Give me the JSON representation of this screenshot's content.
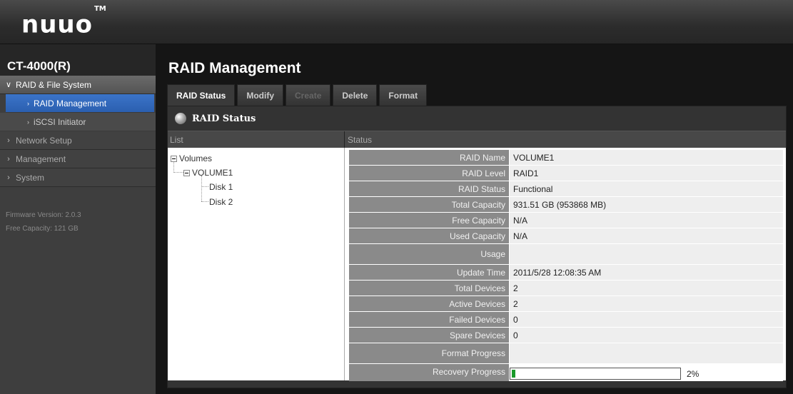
{
  "brand": {
    "logo_text": "nuuo",
    "trademark": "TM"
  },
  "sidebar": {
    "device_name": "CT-4000(R)",
    "sections": [
      {
        "label": "RAID & File System",
        "expanded": true,
        "children": [
          {
            "label": "RAID Management",
            "active": true
          },
          {
            "label": "iSCSI Initiator",
            "active": false
          }
        ]
      },
      {
        "label": "Network Setup",
        "expanded": false
      },
      {
        "label": "Management",
        "expanded": false
      },
      {
        "label": "System",
        "expanded": false
      }
    ],
    "firmware_version": "Firmware Version: 2.0.3",
    "free_capacity": "Free Capacity: 121 GB"
  },
  "main": {
    "title": "RAID Management",
    "tabs": [
      {
        "label": "RAID Status",
        "state": "active"
      },
      {
        "label": "Modify",
        "state": "normal"
      },
      {
        "label": "Create",
        "state": "disabled"
      },
      {
        "label": "Delete",
        "state": "normal"
      },
      {
        "label": "Format",
        "state": "normal"
      }
    ],
    "panel_title": "RAID Status",
    "list_header": "List",
    "status_header": "Status",
    "tree": {
      "root": "Volumes",
      "volume": "VOLUME1",
      "disks": [
        "Disk 1",
        "Disk 2"
      ]
    },
    "status_rows": [
      {
        "label": "RAID Name",
        "value": "VOLUME1"
      },
      {
        "label": "RAID Level",
        "value": "RAID1"
      },
      {
        "label": "RAID Status",
        "value": "Functional"
      },
      {
        "label": "Total Capacity",
        "value": "931.51 GB (953868 MB)"
      },
      {
        "label": "Free Capacity",
        "value": "N/A"
      },
      {
        "label": "Used Capacity",
        "value": "N/A"
      },
      {
        "label": "Usage",
        "value": ""
      },
      {
        "label": "Update Time",
        "value": "2011/5/28 12:08:35 AM"
      },
      {
        "label": "Total Devices",
        "value": "2"
      },
      {
        "label": "Active Devices",
        "value": "2"
      },
      {
        "label": "Failed Devices",
        "value": "0"
      },
      {
        "label": "Spare Devices",
        "value": "0"
      },
      {
        "label": "Format Progress",
        "value": ""
      }
    ],
    "recovery": {
      "label": "Recovery Progress",
      "percent": 2,
      "percent_text": "2%",
      "fill_color": "#1a9a2a"
    }
  }
}
